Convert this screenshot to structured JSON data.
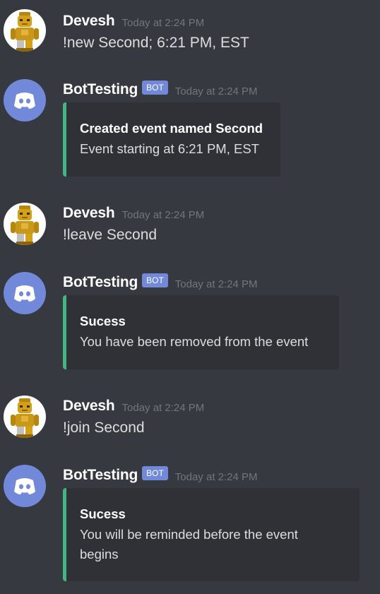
{
  "colors": {
    "background": "#36393f",
    "embed_background": "#2f3136",
    "embed_border": "#43b581",
    "bot_tag": "#7289da",
    "discord_avatar": "#7289da",
    "timestamp": "#72767d"
  },
  "messages": [
    {
      "author": "Devesh",
      "avatar_icon": "c3po-lego-avatar-icon",
      "timestamp": "Today at 2:24 PM",
      "content": "!new Second; 6:21 PM, EST"
    },
    {
      "author": "BotTesting",
      "avatar_icon": "discord-logo-avatar-icon",
      "bot_tag": "BOT",
      "timestamp": "Today at 2:24 PM",
      "embed": {
        "title": "Created event named Second",
        "description": "Event starting at 6:21 PM, EST"
      }
    },
    {
      "author": "Devesh",
      "avatar_icon": "c3po-lego-avatar-icon",
      "timestamp": "Today at 2:24 PM",
      "content": "!leave Second"
    },
    {
      "author": "BotTesting",
      "avatar_icon": "discord-logo-avatar-icon",
      "bot_tag": "BOT",
      "timestamp": "Today at 2:24 PM",
      "embed": {
        "title": "Sucess",
        "description": "You have been removed from the event"
      }
    },
    {
      "author": "Devesh",
      "avatar_icon": "c3po-lego-avatar-icon",
      "timestamp": "Today at 2:24 PM",
      "content": "!join Second"
    },
    {
      "author": "BotTesting",
      "avatar_icon": "discord-logo-avatar-icon",
      "bot_tag": "BOT",
      "timestamp": "Today at 2:24 PM",
      "embed": {
        "title": "Sucess",
        "description": "You will be reminded before the event begins"
      }
    }
  ]
}
